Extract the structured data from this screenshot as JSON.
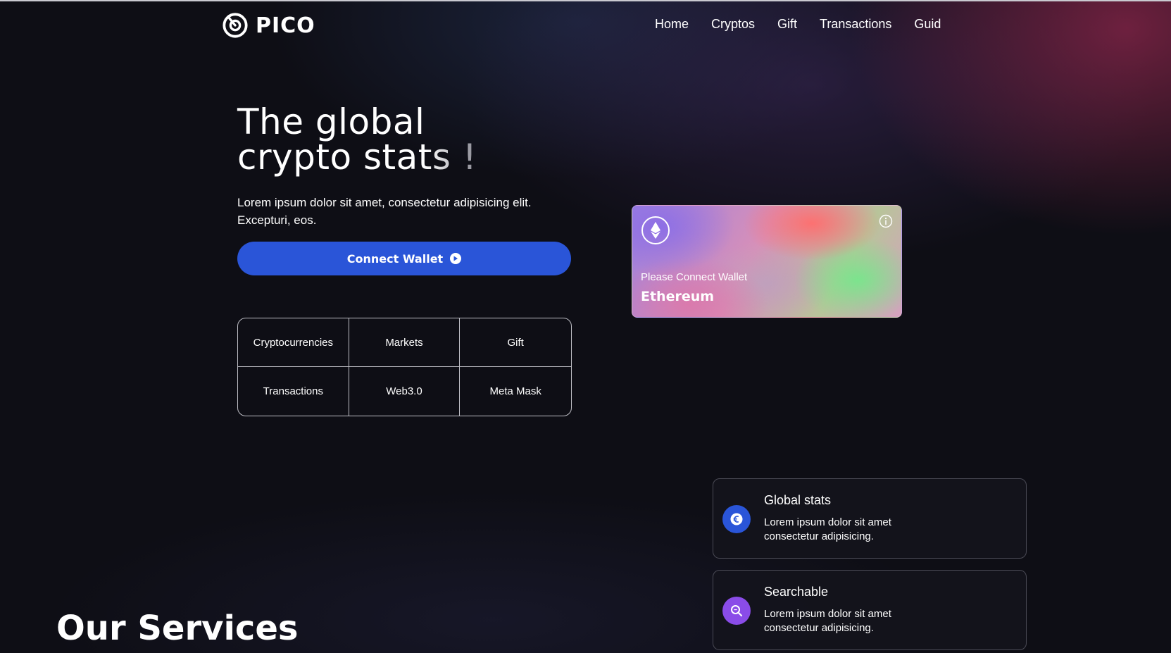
{
  "brand": {
    "name": "PICO"
  },
  "nav": {
    "items": [
      "Home",
      "Cryptos",
      "Gift",
      "Transactions",
      "Guid"
    ]
  },
  "hero": {
    "title_line1": "The global",
    "title_line2_a": "crypto st",
    "title_line2_b": "ats !",
    "subtitle": "Lorem ipsum dolor sit amet, consectetur adipisicing elit. Excepturi, eos.",
    "cta_label": "Connect Wallet"
  },
  "categories": [
    "Cryptocurrencies",
    "Markets",
    "Gift",
    "Transactions",
    "Web3.0",
    "Meta Mask"
  ],
  "wallet_card": {
    "status": "Please Connect Wallet",
    "coin": "Ethereum",
    "coin_icon": "ethereum-icon",
    "info_icon": "info-icon"
  },
  "features": [
    {
      "title": "Global stats",
      "desc": "Lorem ipsum dolor sit amet consectetur adipisicing.",
      "icon": "euro-icon"
    },
    {
      "title": "Searchable",
      "desc": "Lorem ipsum dolor sit amet consectetur adipisicing.",
      "icon": "search-icon"
    }
  ],
  "services": {
    "title": "Our Services"
  },
  "colors": {
    "accent_blue": "#2a55d8",
    "accent_purple": "#8a4ce8",
    "background": "#0e0e15"
  }
}
